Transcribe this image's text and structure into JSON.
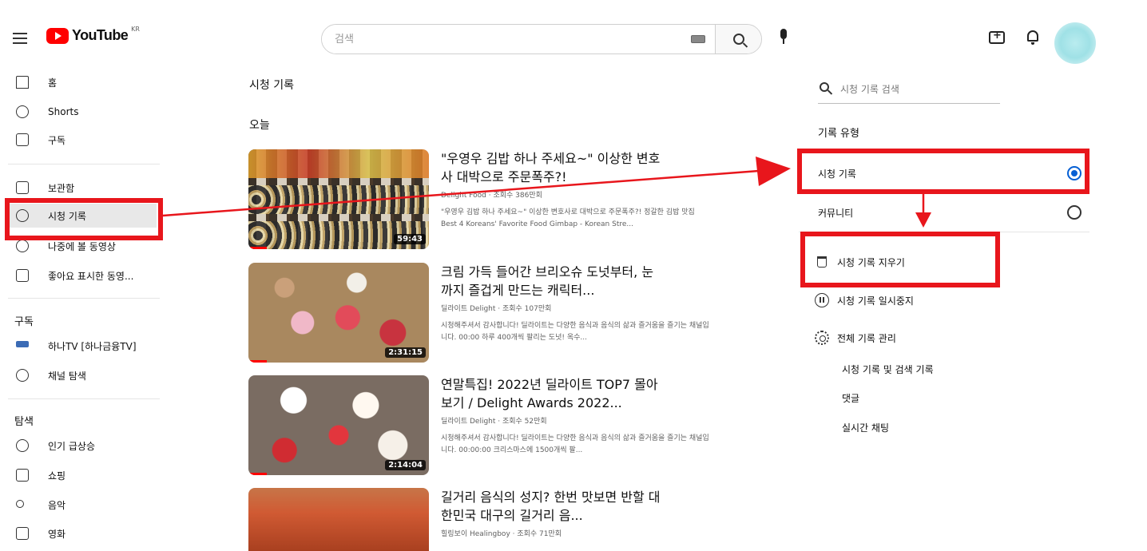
{
  "header": {
    "logo_text": "YouTube",
    "logo_region": "KR",
    "search_placeholder": "검색"
  },
  "sidebar": {
    "main_items": [
      {
        "label": "홈",
        "icon": "home-icon"
      },
      {
        "label": "Shorts",
        "icon": "shorts-icon"
      },
      {
        "label": "구독",
        "icon": "subscriptions-icon"
      }
    ],
    "library_items": [
      {
        "label": "보관함",
        "icon": "library-icon"
      },
      {
        "label": "시청 기록",
        "icon": "history-icon",
        "active": true
      },
      {
        "label": "나중에 볼 동영상",
        "icon": "watch-later-icon"
      },
      {
        "label": "좋아요 표시한 동영...",
        "icon": "like-icon"
      }
    ],
    "subscriptions_heading": "구독",
    "subscriptions": [
      {
        "label": "하나TV [하나금융TV]",
        "icon": "channel-avatar-icon"
      },
      {
        "label": "채널 탐색",
        "icon": "plus-circle-icon"
      }
    ],
    "explore_heading": "탐색",
    "explore_items": [
      {
        "label": "인기 급상승",
        "icon": "trending-icon"
      },
      {
        "label": "쇼핑",
        "icon": "shopping-icon"
      },
      {
        "label": "음악",
        "icon": "music-icon"
      },
      {
        "label": "영화",
        "icon": "movie-icon"
      }
    ]
  },
  "main": {
    "page_title": "시청 기록",
    "section_today": "오늘",
    "videos": [
      {
        "title": "\"우영우 김밥 하나 주세요~\" 이상한 변호사 대박으로 주문폭주?!",
        "meta": "Delight Food · 조회수 386만회",
        "desc": "\"우영우 김밥 하나 주세요~\" 이상한 변호사로 대박으로 주문폭주?! 정갈한 김밥 맛집 Best 4 Koreans' Favorite Food Gimbap - Korean Stre...",
        "duration": "59:43",
        "progress": 0.1
      },
      {
        "title": "크림 가득 들어간 브리오슈 도넛부터, 눈까지 즐겁게 만드는 캐릭터...",
        "meta": "딜라이트 Delight · 조회수 107만회",
        "desc": "시청해주셔서 감사합니다! 딜라이트는 다양한 음식과 음식의 삶과 즐거움을 즐기는 채널입니다. 00:00 하루 400개씩 팔리는 도넛! 옥수...",
        "duration": "2:31:15",
        "progress": 0.1
      },
      {
        "title": "연말특집! 2022년 딜라이트 TOP7 몰아보기 / Delight Awards 2022...",
        "meta": "딜라이트 Delight · 조회수 52만회",
        "desc": "시청해주셔서 감사합니다! 딜라이트는 다양한 음식과 음식의 삶과 즐거움을 즐기는 채널입니다. 00:00:00 크리스마스에 1500개씩 팔...",
        "duration": "2:14:04",
        "progress": 0.1
      },
      {
        "title": "길거리 음식의 성지? 한번 맛보면 반할 대한민국 대구의 길거리 음...",
        "meta": "힐링보이 Healingboy · 조회수 71만회",
        "desc": "",
        "duration": "",
        "progress": 0
      }
    ]
  },
  "right_panel": {
    "search_placeholder": "시청 기록 검색",
    "history_type_heading": "기록 유형",
    "options": [
      {
        "label": "시청 기록",
        "selected": true
      },
      {
        "label": "커뮤니티",
        "selected": false
      }
    ],
    "actions": [
      {
        "label": "시청 기록 지우기",
        "icon": "trash-icon"
      },
      {
        "label": "시청 기록 일시중지",
        "icon": "pause-icon"
      },
      {
        "label": "전체 기록 관리",
        "icon": "gear-icon"
      }
    ],
    "sub_links": [
      "시청 기록 및 검색 기록",
      "댓글",
      "실시간 채팅"
    ]
  },
  "annotation_color": "#e8161c"
}
